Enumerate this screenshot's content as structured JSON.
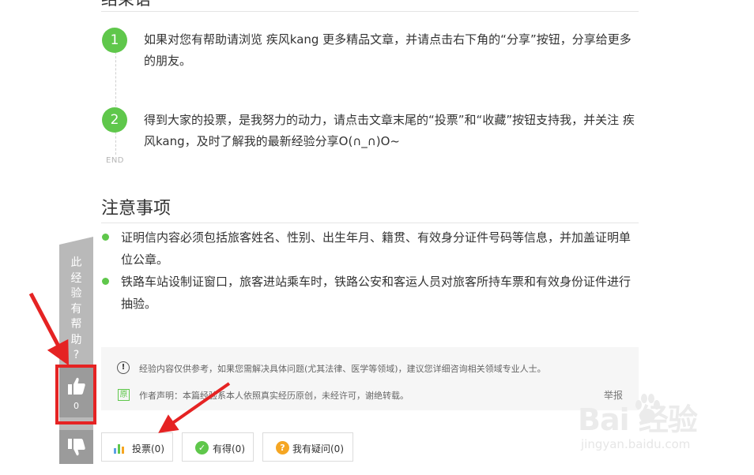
{
  "sections": {
    "conclusion_title": "结束语",
    "notes_title": "注意事项"
  },
  "steps": [
    {
      "number": "1",
      "text": "如果对您有帮助请浏览 疾风kang 更多精品文章，并请点击右下角的“分享”按钮，分享给更多的朋友。"
    },
    {
      "number": "2",
      "text": "得到大家的投票，是我努力的动力，请点击文章末尾的“投票”和“收藏”按钮支持我，并关注 疾风kang，及时了解我的最新经验分享O(∩_∩)O~"
    }
  ],
  "end_label": "END",
  "notes": [
    "证明信内容必须包括旅客姓名、性别、出生年月、籍贯、有效身分证件号码等信息，并加盖证明单位公章。",
    "铁路车站设制证窗口，旅客进站乘车时，铁路公安和客运人员对旅客所持车票和有效身份证件进行抽验。"
  ],
  "disclaimer": {
    "warning_mark": "!",
    "warning": "经验内容仅供参考，如果您需解决具体问题(尤其法律、医学等领域)，建议您详细咨询相关领域专业人士。",
    "original_mark": "原",
    "statement": "作者声明：本篇经验系本人依照真实经历原创，未经许可，谢绝转载。",
    "report": "举报"
  },
  "actions": {
    "vote": "投票(0)",
    "useful": "有得(0)",
    "question": "我有疑问(0)"
  },
  "sidebar": {
    "question": "此\n经\n验\n有\n帮\n助\n?",
    "like_count": "0"
  },
  "watermark": {
    "brand": "Bai  经验",
    "url": "jingyan.baidu.com"
  },
  "colors": {
    "accent_green": "#5fc74b",
    "highlight_red": "#e52323",
    "sidebar_gray": "#b9b9b9"
  },
  "icons": [
    "exclamation-icon",
    "original-icon",
    "bar-chart-icon",
    "check-icon",
    "question-icon",
    "thumbs-up-icon",
    "thumbs-down-icon",
    "paw-icon"
  ]
}
